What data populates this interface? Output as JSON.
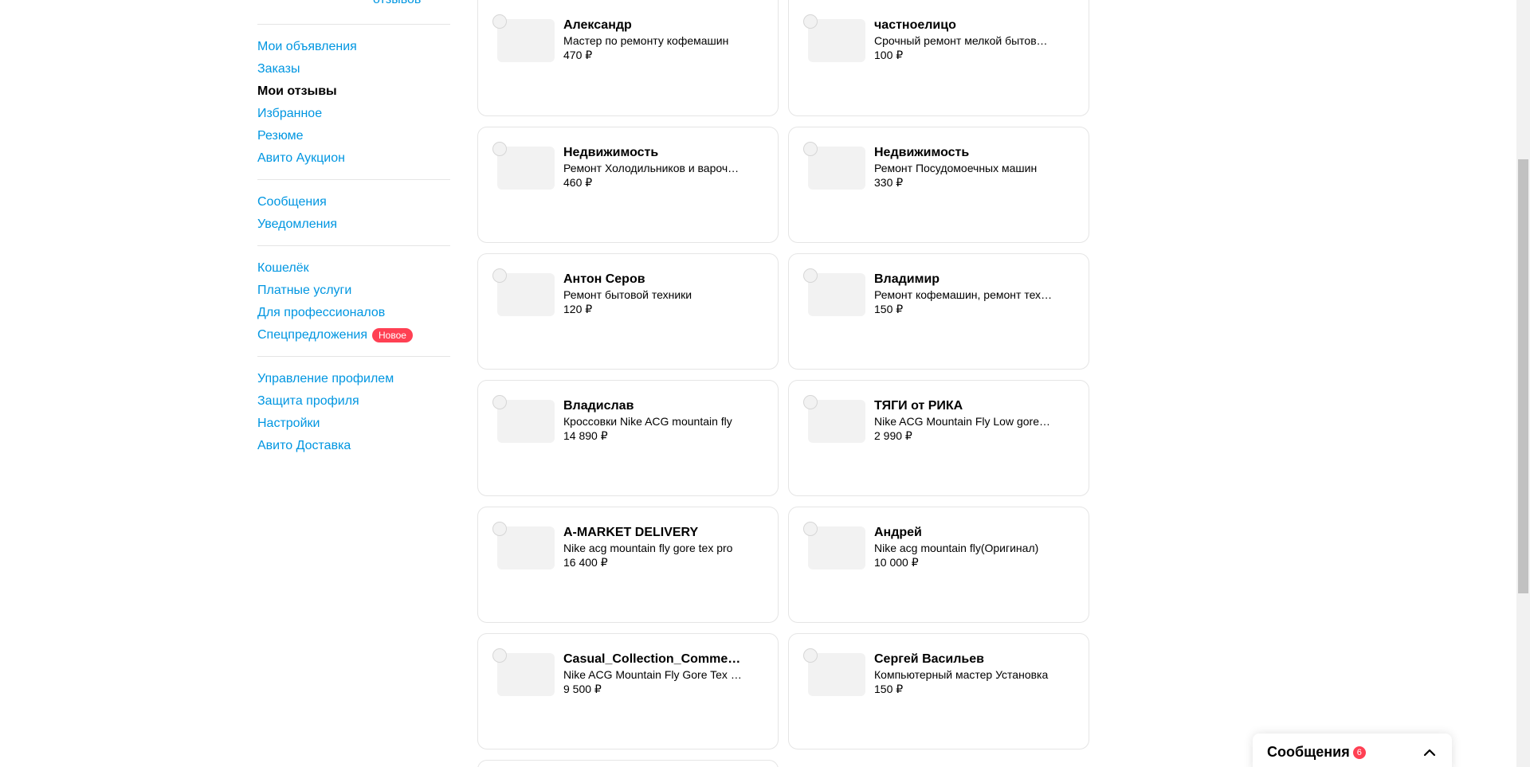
{
  "sidebar": {
    "top_stub": "·",
    "reviews_link": "отзывов",
    "groups": [
      {
        "items": [
          {
            "label": "Мои объявления",
            "active": false
          },
          {
            "label": "Заказы",
            "active": false
          },
          {
            "label": "Мои отзывы",
            "active": true
          },
          {
            "label": "Избранное",
            "active": false
          },
          {
            "label": "Резюме",
            "active": false
          },
          {
            "label": "Авито Аукцион",
            "active": false
          }
        ]
      },
      {
        "items": [
          {
            "label": "Сообщения",
            "active": false
          },
          {
            "label": "Уведомления",
            "active": false
          }
        ]
      },
      {
        "items": [
          {
            "label": "Кошелёк",
            "active": false
          },
          {
            "label": "Платные услуги",
            "active": false
          },
          {
            "label": "Для профессионалов",
            "active": false
          },
          {
            "label": "Спецпредложения",
            "active": false,
            "badge": "Новое"
          }
        ]
      },
      {
        "items": [
          {
            "label": "Управление профилем",
            "active": false
          },
          {
            "label": "Защита профиля",
            "active": false
          },
          {
            "label": "Настройки",
            "active": false
          },
          {
            "label": "Авито Доставка",
            "active": false
          }
        ]
      }
    ]
  },
  "cards": [
    {
      "title": "Александр",
      "desc": "Мастер по ремонту кофемашин",
      "price": "470 ₽"
    },
    {
      "title": "частноелицо",
      "desc": "Срочный ремонт мелкой бытовой техники",
      "price": "100 ₽"
    },
    {
      "title": "Недвижимость",
      "desc": "Ремонт Холодильников и варочных панелей",
      "price": "460 ₽"
    },
    {
      "title": "Недвижимость",
      "desc": "Ремонт Посудомоечных машин",
      "price": "330 ₽"
    },
    {
      "title": "Антон Серов",
      "desc": "Ремонт бытовой техники",
      "price": "120 ₽"
    },
    {
      "title": "Владимир",
      "desc": "Ремонт кофемашин, ремонт техники",
      "price": "150 ₽"
    },
    {
      "title": "Владислав",
      "desc": "Кроссовки Nike ACG mountain fly",
      "price": "14 890 ₽"
    },
    {
      "title": "ТЯГИ от РИКА",
      "desc": "Nike ACG Mountain Fly Low gore-tex",
      "price": "2 990 ₽"
    },
    {
      "title": "A-MARKET DELIVERY",
      "desc": "Nike acg mountain fly gore tex pro",
      "price": "16 400 ₽"
    },
    {
      "title": "Андрей",
      "desc": "Nike acg mountain fly(Оригинал)",
      "price": "10 000 ₽"
    },
    {
      "title": "Casual_Collection_Commerce",
      "desc": "Nike ACG Mountain Fly Gore Tex Low",
      "price": "9 500 ₽"
    },
    {
      "title": "Сергей Васильев",
      "desc": "Компьютерный мастер Установка",
      "price": "150 ₽"
    }
  ],
  "messages_widget": {
    "label": "Сообщения",
    "count": "6",
    "chevron_icon": "chevron-up-icon"
  },
  "colors": {
    "link": "#0096e1",
    "badge": "#ff4053",
    "border": "#e5e5e5",
    "thumb": "#f2f2f2"
  }
}
